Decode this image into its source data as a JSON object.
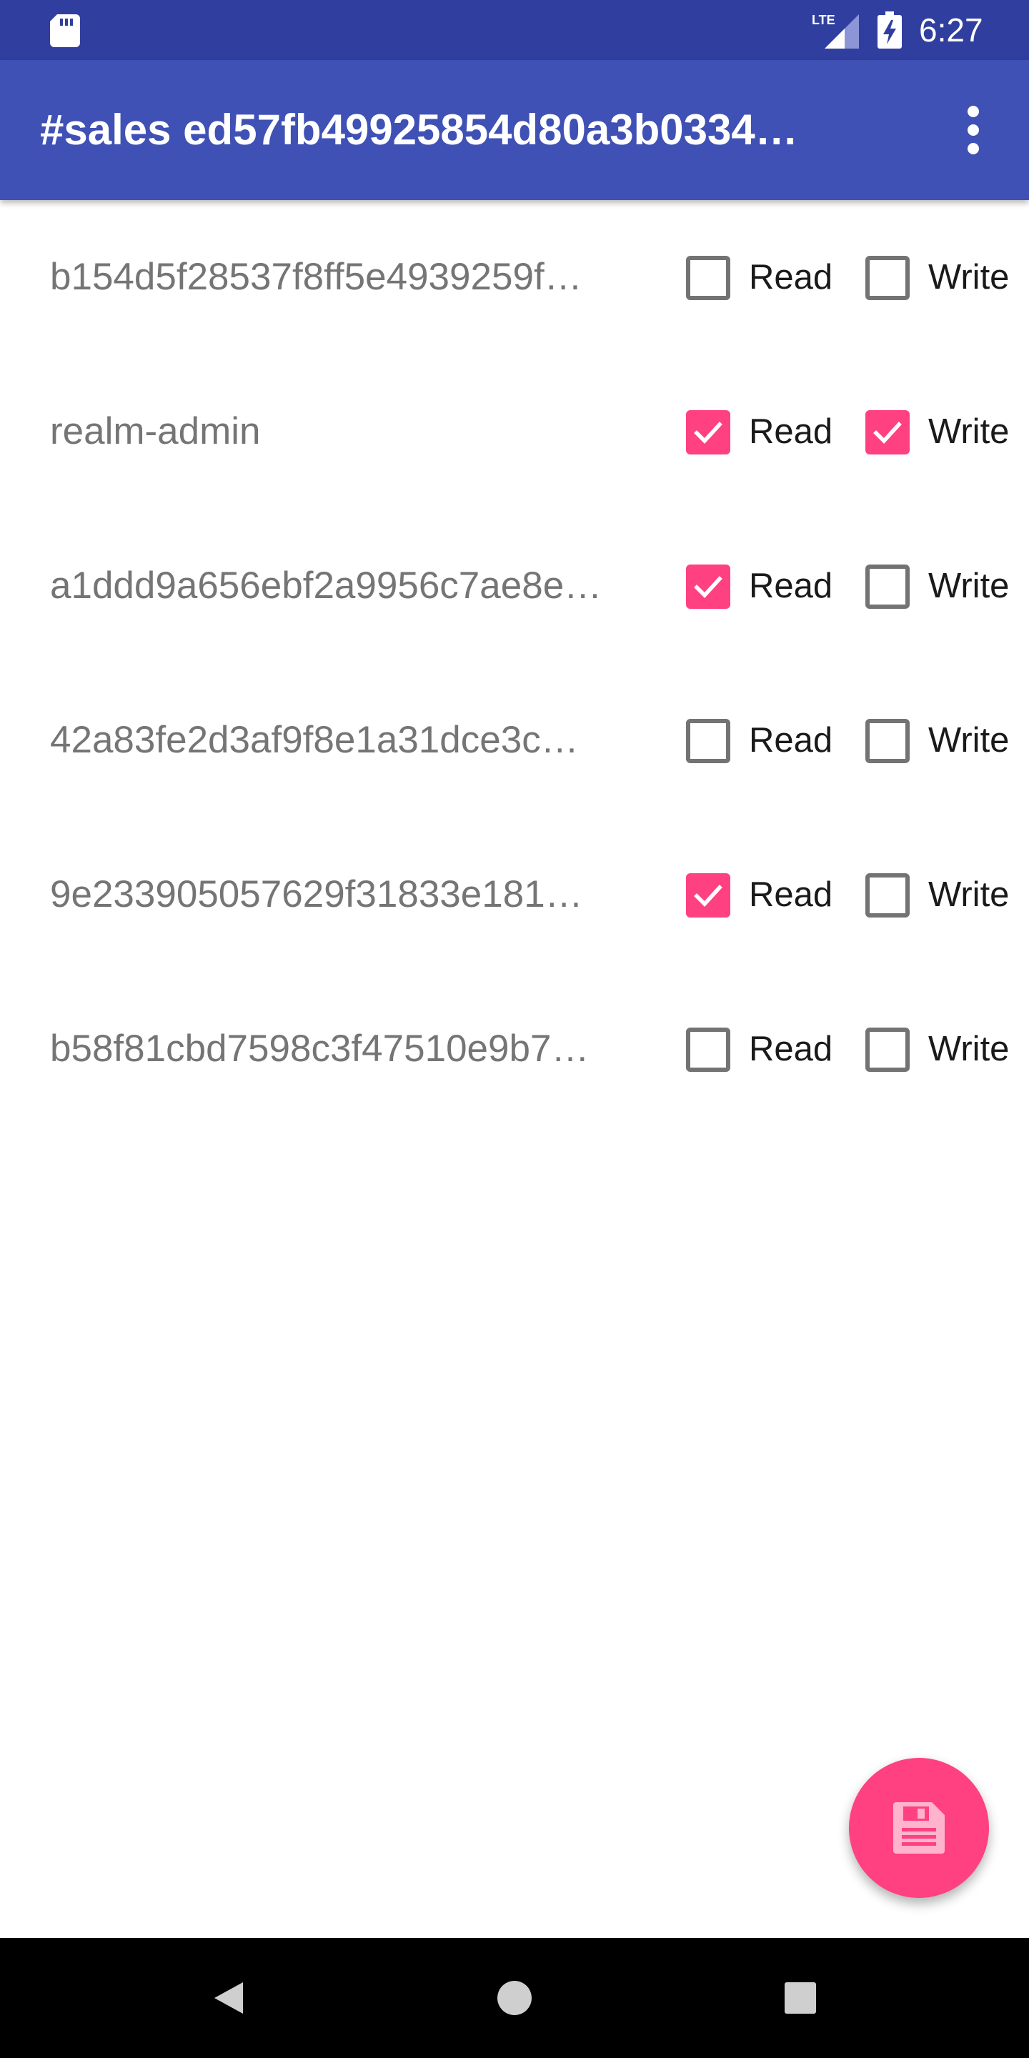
{
  "status_bar": {
    "network": "LTE",
    "time": "6:27"
  },
  "app_bar": {
    "title": "#sales ed57fb49925854d80a3b0334…",
    "overflow_icon": "more-vert-icon"
  },
  "permissions": [
    {
      "user": "b154d5f28537f8ff5e4939259f…",
      "read": false,
      "write": false
    },
    {
      "user": "realm-admin",
      "read": true,
      "write": true
    },
    {
      "user": "a1ddd9a656ebf2a9956c7ae8e…",
      "read": true,
      "write": false
    },
    {
      "user": "42a83fe2d3af9f8e1a31dce3c…",
      "read": false,
      "write": false
    },
    {
      "user": "9e233905057629f31833e181…",
      "read": true,
      "write": false
    },
    {
      "user": "b58f81cbd7598c3f47510e9b7…",
      "read": false,
      "write": false
    }
  ],
  "labels": {
    "read": "Read",
    "write": "Write"
  },
  "fab": {
    "icon": "save-icon"
  },
  "colors": {
    "status_bar": "#303F9F",
    "primary": "#3F51B5",
    "accent": "#FF4081"
  }
}
